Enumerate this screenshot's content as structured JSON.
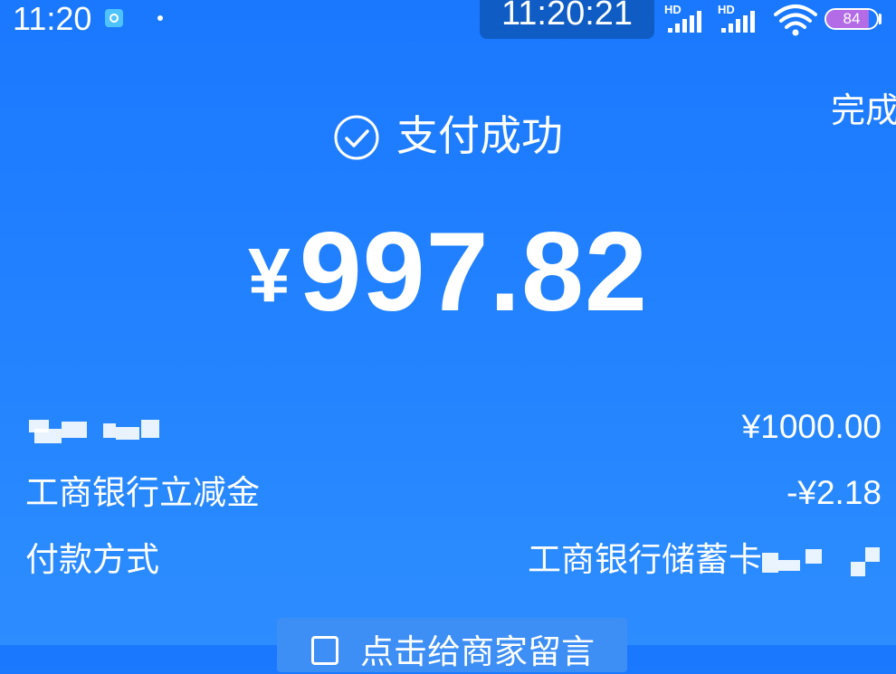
{
  "status_bar": {
    "time": "11:20",
    "clock_overlay": "11:20:21",
    "signal_1_label": "HD",
    "signal_2_label": "HD",
    "battery": "84"
  },
  "header": {
    "done_label": "完成",
    "success_label": "支付成功"
  },
  "payment": {
    "currency_symbol": "¥",
    "amount": "997.82",
    "details": [
      {
        "label": "",
        "value": "¥1000.00"
      },
      {
        "label": "工商银行立减金",
        "value": "-¥2.18"
      },
      {
        "label": "付款方式",
        "value": "工商银行储蓄卡"
      }
    ]
  },
  "bottom_button": {
    "label": "点击给商家留言"
  }
}
